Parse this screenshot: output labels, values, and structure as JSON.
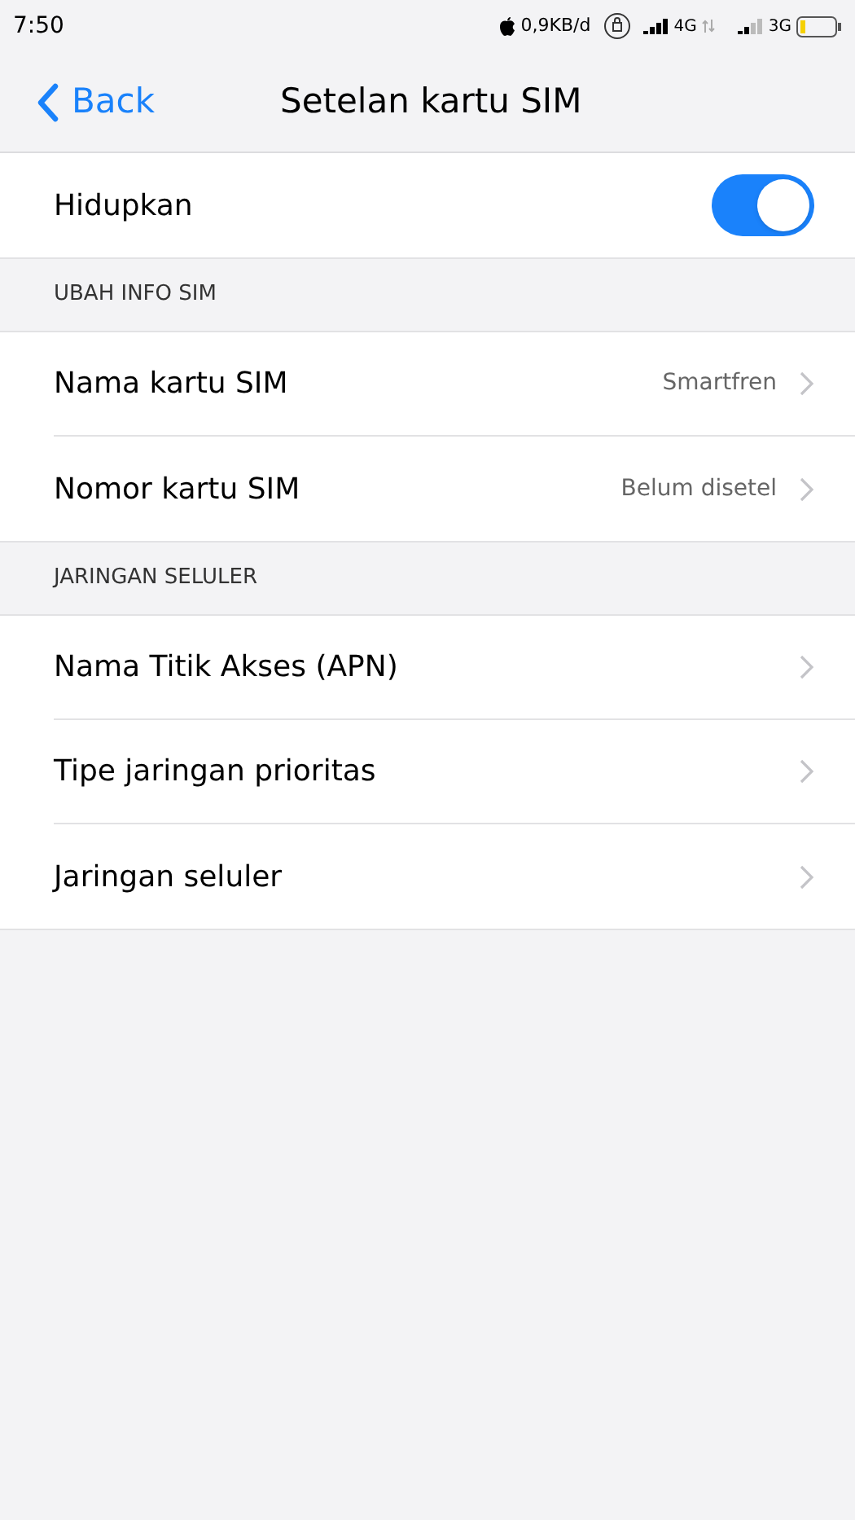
{
  "status_bar": {
    "time": "7:50",
    "data_rate": "0,9KB/d",
    "network_1": "4G",
    "network_2": "3G"
  },
  "nav": {
    "back": "Back",
    "title": "Setelan kartu SIM"
  },
  "toggle": {
    "label": "Hidupkan",
    "on": true
  },
  "sections": [
    {
      "header": "UBAH INFO SIM",
      "rows": [
        {
          "label": "Nama kartu SIM",
          "value": "Smartfren"
        },
        {
          "label": "Nomor kartu SIM",
          "value": "Belum disetel"
        }
      ]
    },
    {
      "header": "JARINGAN SELULER",
      "rows": [
        {
          "label": "Nama Titik Akses (APN)"
        },
        {
          "label": "Tipe jaringan prioritas"
        },
        {
          "label": "Jaringan seluler"
        }
      ]
    }
  ]
}
